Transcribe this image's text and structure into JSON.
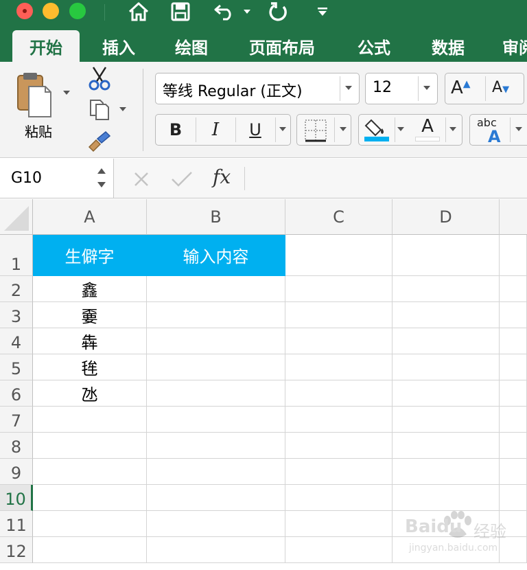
{
  "colors": {
    "brand_green": "#217346",
    "header_cell_fill": "#00b0f0",
    "selected_row_accent": "#217346"
  },
  "toolbar": {
    "icons": [
      "home-icon",
      "save-icon",
      "undo-icon",
      "redo-icon",
      "customize-toolbar-icon"
    ]
  },
  "tabs": [
    "开始",
    "插入",
    "绘图",
    "页面布局",
    "公式",
    "数据",
    "审阅"
  ],
  "active_tab": "开始",
  "ribbon": {
    "paste_label": "粘贴",
    "font_name": "等线 Regular (正文)",
    "font_size": "12",
    "bold": "B",
    "italic": "I",
    "underline": "U",
    "grow_font": "A",
    "shrink_font": "A",
    "font_color_glyph": "A",
    "abc_glyph": "abc",
    "abc_a": "A"
  },
  "formula_bar": {
    "name_box": "G10",
    "fx": "fx",
    "content": ""
  },
  "sheet": {
    "columns": [
      "A",
      "B",
      "C",
      "D"
    ],
    "rows": [
      "1",
      "2",
      "3",
      "4",
      "5",
      "6",
      "7",
      "8",
      "9",
      "10",
      "11",
      "12"
    ],
    "selected_row": "10",
    "cells": {
      "A1": "生僻字",
      "B1": "输入内容",
      "A2": "鑫",
      "A3": "嫑",
      "A4": "犇",
      "A5": "毪",
      "A6": "氹"
    }
  },
  "watermark": {
    "brand": "Baidu",
    "suffix": "经验",
    "url": "jingyan.baidu.com"
  }
}
